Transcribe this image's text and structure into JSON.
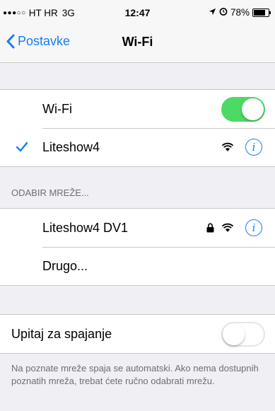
{
  "status": {
    "signal_dots": "●●●○○",
    "carrier": "HT HR",
    "network": "3G",
    "time": "12:47",
    "battery_text": "78%",
    "battery_level": 0.78
  },
  "nav": {
    "back_label": "Postavke",
    "title": "Wi-Fi"
  },
  "wifi": {
    "toggle_label": "Wi-Fi",
    "enabled": true,
    "connected_network": "Liteshow4"
  },
  "choose_network": {
    "header": "ODABIR MREŽE...",
    "networks": [
      {
        "name": "Liteshow4 DV1",
        "locked": true
      }
    ],
    "other_label": "Drugo..."
  },
  "ask_to_join": {
    "label": "Upitaj za spajanje",
    "enabled": false,
    "note": "Na poznate mreže spaja se automatski. Ako nema dostupnih poznatih mreža, trebat ćete ručno odabrati mrežu."
  },
  "colors": {
    "accent": "#147efb",
    "toggle_on": "#4cd964",
    "background": "#efeff4"
  },
  "icons": [
    "chevron-left-icon",
    "check-icon",
    "wifi-icon",
    "info-icon",
    "lock-icon",
    "location-arrow-icon",
    "alarm-icon",
    "battery-icon"
  ]
}
